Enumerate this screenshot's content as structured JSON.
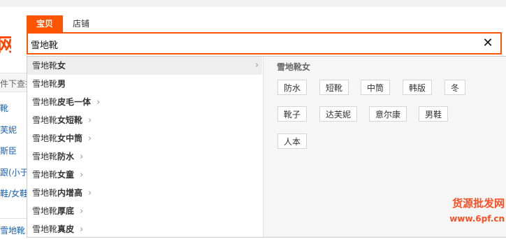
{
  "page": {
    "logo_fragment": "网",
    "filter_text": "件下查找",
    "side_links": [
      "靴",
      "芙妮",
      "斯臣",
      "跟(小于",
      "鞋/女鞋",
      "雪地靴"
    ]
  },
  "search": {
    "tabs": [
      {
        "label": "宝贝",
        "active": true
      },
      {
        "label": "店铺",
        "active": false
      }
    ],
    "query": "雪地靴",
    "clear_glyph": "✕"
  },
  "suggestions": {
    "prefix": "雪地靴",
    "items": [
      {
        "suffix": "女"
      },
      {
        "suffix": "男"
      },
      {
        "suffix": "皮毛一体"
      },
      {
        "suffix": "女短靴"
      },
      {
        "suffix": "女中筒"
      },
      {
        "suffix": "防水"
      },
      {
        "suffix": "女童"
      },
      {
        "suffix": "内增高"
      },
      {
        "suffix": "厚底"
      },
      {
        "suffix": "真皮"
      }
    ],
    "chevron": "›"
  },
  "hot_panel": {
    "title": "雪地靴女",
    "chips": [
      "防水",
      "短靴",
      "中筒",
      "韩版",
      "冬",
      "靴子",
      "达芙妮",
      "意尔康",
      "男鞋",
      "人本"
    ]
  },
  "watermark": {
    "line1": "货源批发网",
    "line2": "www.6pf.cn"
  },
  "colors": {
    "accent": "#ff5500",
    "link": "#1a5fb4"
  }
}
